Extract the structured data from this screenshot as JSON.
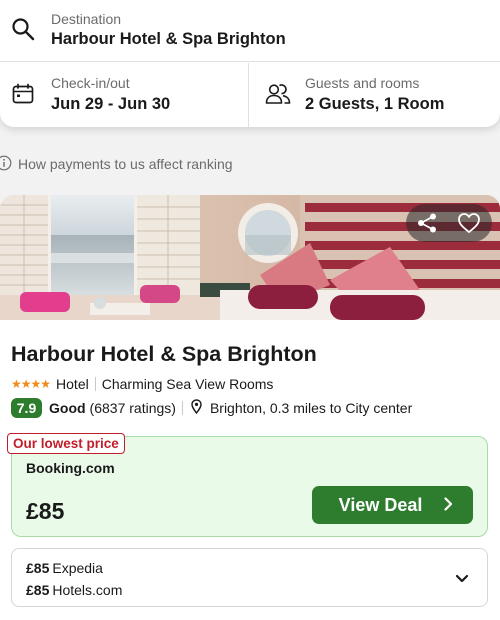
{
  "search": {
    "destination_label": "Destination",
    "destination_value": "Harbour Hotel & Spa Brighton",
    "dates_label": "Check-in/out",
    "dates_value": "Jun 29 - Jun 30",
    "guests_label": "Guests and rooms",
    "guests_value": "2 Guests, 1 Room"
  },
  "info": {
    "text": "How payments to us affect ranking"
  },
  "hotel": {
    "name": "Harbour Hotel & Spa Brighton",
    "stars": 4,
    "stars_glyph": "★★★★",
    "type": "Hotel",
    "tagline": "Charming Sea View Rooms",
    "score": "7.9",
    "rating_word": "Good",
    "rating_count": "(6837 ratings)",
    "location": "Brighton, 0.3 miles to City center"
  },
  "deal": {
    "badge": "Our lowest price",
    "provider": "Booking.com",
    "price": "£85",
    "button_label": "View Deal"
  },
  "other_deals": [
    {
      "price": "£85",
      "provider": "Expedia"
    },
    {
      "price": "£85",
      "provider": "Hotels.com"
    }
  ],
  "colors": {
    "accent_green": "#2e7d2e",
    "deal_background": "#eafae9",
    "badge_red": "#c21d2b",
    "star_orange": "#f08b1d"
  },
  "icons": [
    "search-icon",
    "calendar-icon",
    "guests-icon",
    "info-icon",
    "share-icon",
    "heart-icon",
    "location-pin-icon",
    "chevron-right-icon",
    "chevron-down-icon"
  ]
}
